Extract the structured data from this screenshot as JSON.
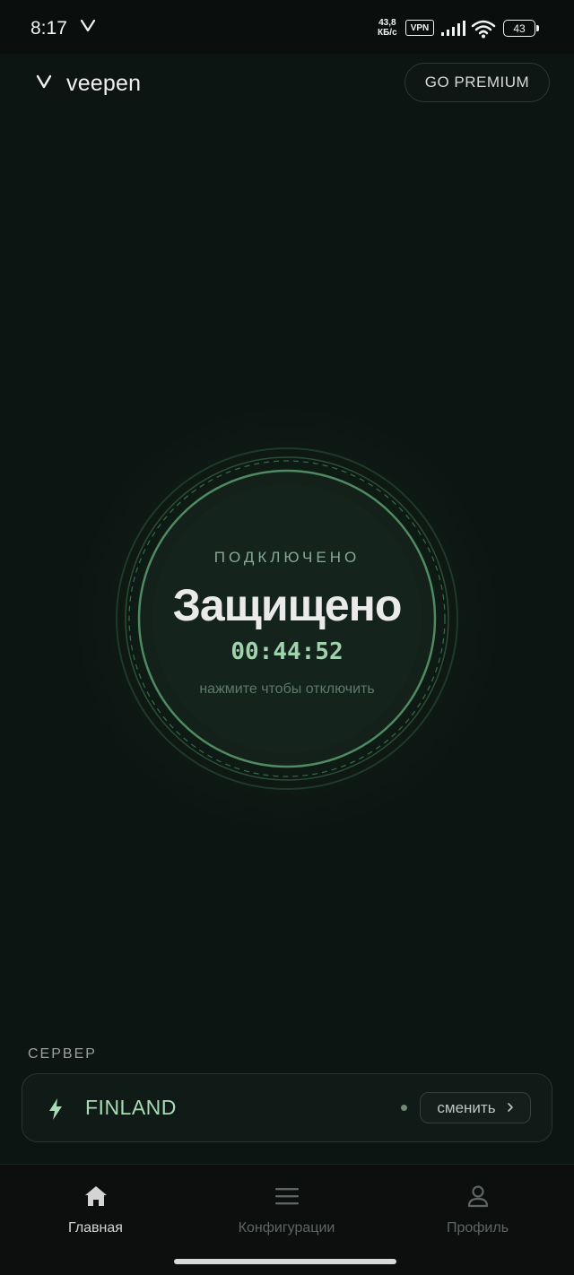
{
  "status_bar": {
    "time": "8:17",
    "speed_value": "43,8",
    "speed_unit": "КБ/с",
    "vpn_badge": "VPN",
    "battery": "43"
  },
  "header": {
    "app_name": "veepen",
    "premium_label": "GO PREMIUM"
  },
  "connection": {
    "status": "ПОДКЛЮЧЕНО",
    "title": "Защищено",
    "timer": "00:44:52",
    "hint": "нажмите чтобы отключить"
  },
  "server": {
    "section_label": "СЕРВЕР",
    "name": "FINLAND",
    "change_label": "сменить"
  },
  "nav": {
    "items": [
      {
        "label": "Главная",
        "icon": "home-icon",
        "active": true
      },
      {
        "label": "Конфигурации",
        "icon": "menu-icon",
        "active": false
      },
      {
        "label": "Профиль",
        "icon": "profile-icon",
        "active": false
      }
    ]
  },
  "colors": {
    "background": "#0d1512",
    "accent_green": "#a9dcb5",
    "timer_green": "#9fd2ad"
  }
}
